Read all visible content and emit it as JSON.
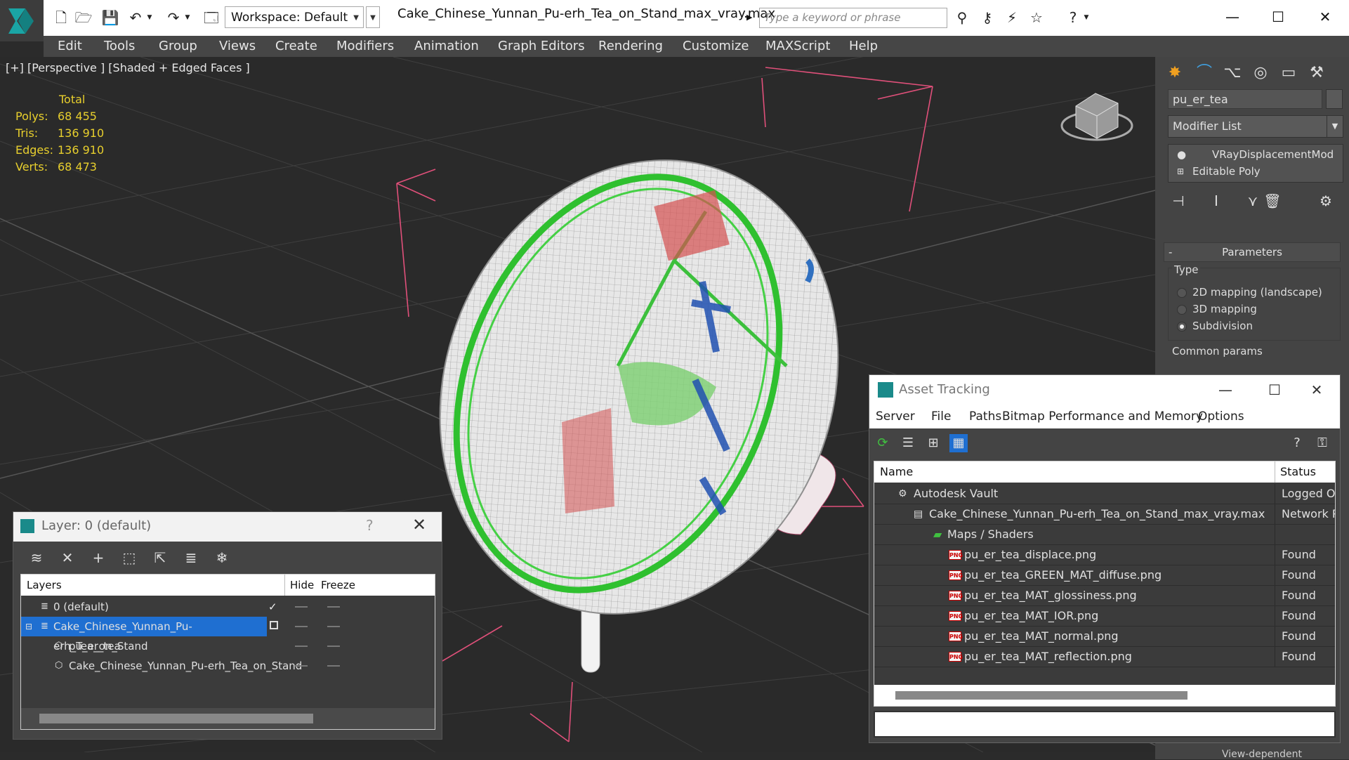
{
  "app": {
    "workspace_label": "Workspace: Default",
    "document_title": "Cake_Chinese_Yunnan_Pu-erh_Tea_on_Stand_max_vray.max",
    "search_placeholder": "Type a keyword or phrase"
  },
  "menu": [
    "Edit",
    "Tools",
    "Group",
    "Views",
    "Create",
    "Modifiers",
    "Animation",
    "Graph Editors",
    "Rendering",
    "Customize",
    "MAXScript",
    "Help"
  ],
  "viewport": {
    "label": "[+] [Perspective ] [Shaded + Edged Faces ]",
    "stats_header": "Total",
    "stats": [
      {
        "label": "Polys:",
        "value": "68 455"
      },
      {
        "label": "Tris:",
        "value": "136 910"
      },
      {
        "label": "Edges:",
        "value": "136 910"
      },
      {
        "label": "Verts:",
        "value": "68 473"
      }
    ]
  },
  "command_panel": {
    "object_name": "pu_er_tea",
    "modifier_list": "Modifier List",
    "stack": [
      "VRayDisplacementMod",
      "Editable Poly"
    ],
    "rollout_title": "Parameters",
    "rollout_minus": "-",
    "type_label": "Type",
    "type_options": [
      {
        "label": "2D mapping (landscape)",
        "selected": false
      },
      {
        "label": "3D mapping",
        "selected": false
      },
      {
        "label": "Subdivision",
        "selected": true
      }
    ],
    "common_params": "Common params",
    "view_dependent": "View-dependent"
  },
  "layer_dialog": {
    "title": "Layer: 0 (default)",
    "help": "?",
    "headers": {
      "layers": "Layers",
      "hide": "Hide",
      "freeze": "Freeze"
    },
    "rows": [
      {
        "name": "0 (default)",
        "indent": 1,
        "active": true,
        "selected": false
      },
      {
        "name": "Cake_Chinese_Yunnan_Pu-erh_Tea_on_Stand",
        "indent": 1,
        "active": false,
        "selected": true
      },
      {
        "name": "pu_er_tea",
        "indent": 2,
        "active": false,
        "selected": false
      },
      {
        "name": "Cake_Chinese_Yunnan_Pu-erh_Tea_on_Stand",
        "indent": 2,
        "active": false,
        "selected": false
      }
    ]
  },
  "asset_tracking": {
    "title": "Asset Tracking",
    "menu": [
      "Server",
      "File",
      "Paths",
      "Bitmap Performance and Memory",
      "Options"
    ],
    "headers": {
      "name": "Name",
      "status": "Status"
    },
    "rows": [
      {
        "name": "Autodesk Vault",
        "status": "Logged Ou",
        "indent": 1
      },
      {
        "name": "Cake_Chinese_Yunnan_Pu-erh_Tea_on_Stand_max_vray.max",
        "status": "Network Pa",
        "indent": 2
      },
      {
        "name": "Maps / Shaders",
        "status": "",
        "indent": 3
      },
      {
        "name": "pu_er_tea_displace.png",
        "status": "Found",
        "indent": 4
      },
      {
        "name": "pu_er_tea_GREEN_MAT_diffuse.png",
        "status": "Found",
        "indent": 4
      },
      {
        "name": "pu_er_tea_MAT_glossiness.png",
        "status": "Found",
        "indent": 4
      },
      {
        "name": "pu_er_tea_MAT_IOR.png",
        "status": "Found",
        "indent": 4
      },
      {
        "name": "pu_er_tea_MAT_normal.png",
        "status": "Found",
        "indent": 4
      },
      {
        "name": "pu_er_tea_MAT_reflection.png",
        "status": "Found",
        "indent": 4
      }
    ],
    "png_badge": "PNG"
  },
  "colors": {
    "accent_selected": "#1f6fd1",
    "stats_yellow": "#e8cf2d",
    "wire_green": "#2fc02f",
    "gizmo_pink": "#e0507a"
  }
}
